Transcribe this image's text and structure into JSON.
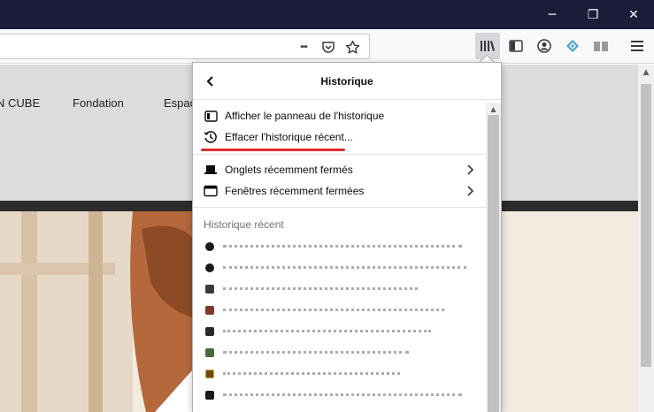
{
  "window": {
    "minimize_glyph": "─",
    "maximize_glyph": "❐",
    "close_glyph": "✕"
  },
  "urlbar": {
    "more_glyph": "•••"
  },
  "toolbar": {
    "icons": [
      "library-icon",
      "sidebar-icon",
      "account-icon",
      "extension-icon",
      "reader-icon",
      "menu-icon"
    ]
  },
  "site": {
    "nav_items": [
      "N CUBE",
      "Fondation",
      "Espac"
    ]
  },
  "panel": {
    "title": "Historique",
    "items": [
      {
        "label": "Afficher le panneau de l'historique",
        "icon": "sidebar-icon"
      },
      {
        "label": "Effacer l'historique récent...",
        "icon": "history-clock-icon"
      }
    ],
    "submenus": [
      {
        "label": "Onglets récemment fermés",
        "icon": "laptop-icon"
      },
      {
        "label": "Fenêtres récemment fermées",
        "icon": "window-icon"
      }
    ],
    "recent_label": "Historique récent"
  },
  "colors": {
    "titlebar": "#1c1b3a",
    "underline": "#e22b2b"
  }
}
